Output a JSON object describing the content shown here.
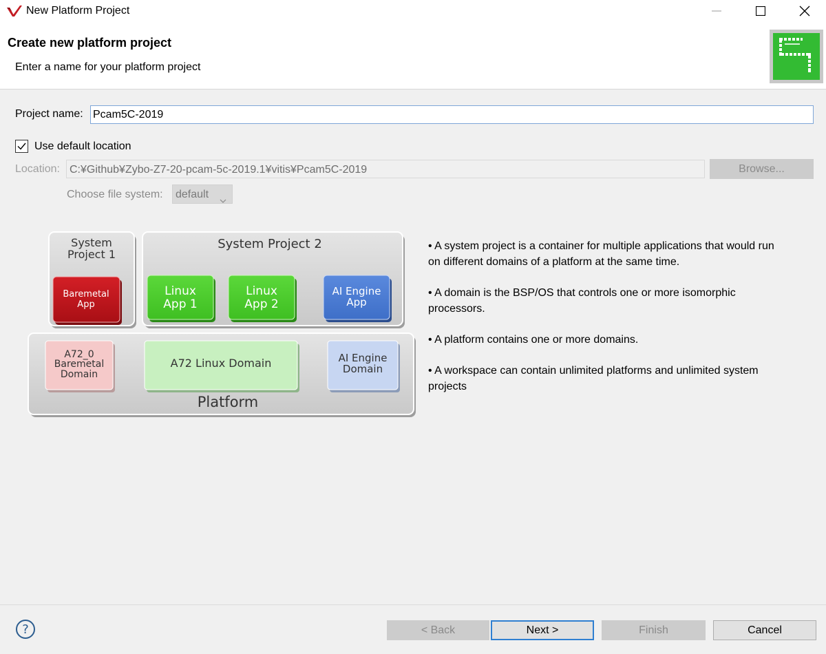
{
  "window": {
    "title": "New Platform Project",
    "controls": [
      "minimize-icon",
      "maximize-icon",
      "close-icon"
    ]
  },
  "header": {
    "title": "Create new platform project",
    "subtitle": "Enter a name for your platform project",
    "logo_icon": "wizard-logo-icon"
  },
  "form": {
    "project_name_label": "Project name:",
    "project_name_value": "Pcam5C-2019",
    "use_default_label": "Use default location",
    "use_default_checked": true,
    "location_label": "Location:",
    "location_value": "C:¥Github¥Zybo-Z7-20-pcam-5c-2019.1¥vitis¥Pcam5C-2019",
    "browse_label": "Browse...",
    "file_system_label": "Choose file system:",
    "file_system_value": "default"
  },
  "diagram": {
    "system_project_1": "System Project 1",
    "system_project_1_line1": "System",
    "system_project_1_line2": "Project 1",
    "system_project_2": "System Project 2",
    "baremetal_app_line1": "Baremetal",
    "baremetal_app_line2": "App",
    "linux_app_1_line1": "Linux",
    "linux_app_1_line2": "App 1",
    "linux_app_2_line1": "Linux",
    "linux_app_2_line2": "App 2",
    "ai_engine_app_line1": "AI Engine",
    "ai_engine_app_line2": "App",
    "a72_baremetal_line1": "A72_0",
    "a72_baremetal_line2": "Baremetal",
    "a72_baremetal_line3": "Domain",
    "a72_linux_domain": "A72 Linux Domain",
    "ai_engine_domain_line1": "AI Engine",
    "ai_engine_domain_line2": "Domain",
    "platform": "Platform"
  },
  "bullets": [
    "• A system project is a container for multiple applications that would run on different domains of a platform at the same time.",
    "• A domain is the BSP/OS that controls one or more isomorphic processors.",
    "• A platform contains one or more domains.",
    "• A workspace can contain unlimited platforms and unlimited system projects"
  ],
  "buttons": {
    "help_icon": "help-icon",
    "back": "< Back",
    "next": "Next >",
    "finish": "Finish",
    "cancel": "Cancel"
  },
  "colors": {
    "next_focus_border": "#2f7fd1",
    "baremetal_app": "#c8161d",
    "linux_app": "#4ccd2a",
    "ai_engine_app": "#4f7fd6",
    "logo_green": "#33bb33"
  }
}
